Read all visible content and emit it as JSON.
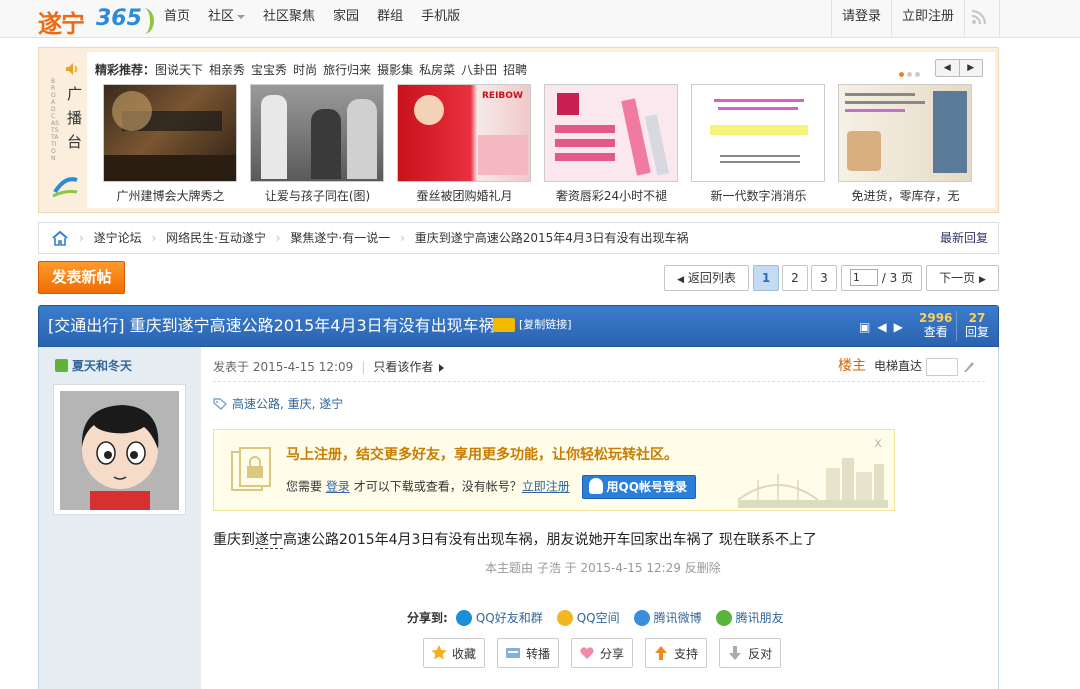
{
  "logo": {
    "part1": "遂宁",
    "part2": "365"
  },
  "nav": {
    "items": [
      {
        "label": "首页"
      },
      {
        "label": "社区",
        "has_dropdown": true
      },
      {
        "label": "社区聚焦"
      },
      {
        "label": "家园"
      },
      {
        "label": "群组"
      },
      {
        "label": "手机版"
      }
    ],
    "login": "请登录",
    "register": "立即注册",
    "rss_icon": "rss-icon"
  },
  "broadcast": {
    "side_title": "广播台",
    "side_sub": "BROADCASTSTATION",
    "picks_label": "精彩推荐：",
    "picks": [
      "图说天下",
      "相亲秀",
      "宝宝秀",
      "时尚",
      "旅行归来",
      "摄影集",
      "私房菜",
      "八卦田",
      "招聘"
    ],
    "items": [
      {
        "caption": "广州建博会大牌秀之"
      },
      {
        "caption": "让爱与孩子同在(图)"
      },
      {
        "caption": "蚕丝被团购婚礼月"
      },
      {
        "caption": "奢资唇彩24小时不褪"
      },
      {
        "caption": "新一代数字消消乐"
      },
      {
        "caption": "免进货，零库存，无"
      }
    ]
  },
  "breadcrumb": {
    "items": [
      "遂宁论坛",
      "网络民生·互动遂宁",
      "聚焦遂宁·有一说一",
      "重庆到遂宁高速公路2015年4月3日有没有出现车祸"
    ],
    "latest_reply": "最新回复"
  },
  "actions": {
    "new_post": "发表新帖"
  },
  "pager": {
    "back": "返回列表",
    "pages": [
      "1",
      "2",
      "3"
    ],
    "current": "1",
    "input_value": "1",
    "total": "/ 3 页",
    "next": "下一页"
  },
  "thread": {
    "title": "[交通出行] 重庆到遂宁高速公路2015年4月3日有没有出现车祸",
    "copy_link": "[复制链接]",
    "views": "2996",
    "views_label": "查看",
    "replies": "27",
    "replies_label": "回复"
  },
  "post": {
    "author": "夏天和冬天",
    "posted_at": "发表于 2015-4-15 12:09",
    "only_author": "只看该作者",
    "floor": "楼主",
    "jump_label": "电梯直达",
    "tags": "高速公路, 重庆, 遂宁",
    "content_pre": "重庆到",
    "content_kw": "遂宁",
    "content_post": "高速公路2015年4月3日有没有出现车祸，朋友说她开车回家出车祸了 现在联系不上了",
    "edited": "本主题由 子浩 于 2015-4-15 12:29 反删除"
  },
  "register_box": {
    "headline": "马上注册，结交更多好友，享用更多功能，让你轻松玩转社区。",
    "text_pre": "您需要",
    "login_link": "登录",
    "text_mid": "才可以下载或查看，没有帐号？",
    "register_link": "立即注册",
    "qq_button": "用QQ帐号登录",
    "close": "x"
  },
  "share": {
    "label": "分享到:",
    "items": [
      {
        "label": "QQ好友和群",
        "icon": "qq-icon",
        "color": "#1a8fd8"
      },
      {
        "label": "QQ空间",
        "icon": "qzone-icon",
        "color": "#f2b823"
      },
      {
        "label": "腾讯微博",
        "icon": "tencent-weibo-icon",
        "color": "#3a8edc"
      },
      {
        "label": "腾讯朋友",
        "icon": "tencent-friend-icon",
        "color": "#5bb53a"
      }
    ]
  },
  "post_actions": [
    {
      "label": "收藏",
      "icon": "star-icon"
    },
    {
      "label": "转播",
      "icon": "rebroadcast-icon"
    },
    {
      "label": "分享",
      "icon": "heart-icon"
    },
    {
      "label": "支持",
      "icon": "thumbs-up-arrow-icon"
    },
    {
      "label": "反对",
      "icon": "thumbs-down-arrow-icon"
    }
  ],
  "colors": {
    "accent_orange": "#f07a10",
    "header_blue": "#2a64b0",
    "link": "#336699"
  }
}
